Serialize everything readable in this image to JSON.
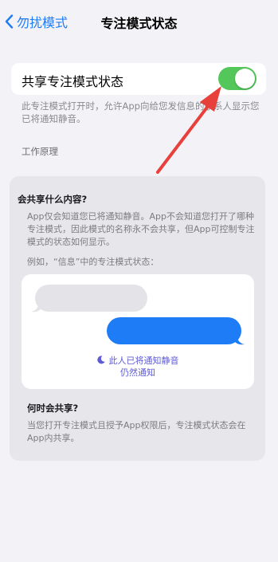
{
  "nav": {
    "back_label": "勿扰模式",
    "title": "专注模式状态"
  },
  "share_toggle": {
    "label": "共享专注模式状态",
    "on": true,
    "on_color": "#53c75a"
  },
  "footer_note": "此专注模式打开时，允许App向给您发信息的联系人显示您已将通知静音。",
  "section_header": "工作原理",
  "info_card": {
    "q1": "会共享什么内容?",
    "p1": "App仅会知道您已将通知静音。App不会知道您打开了哪种专注模式，因此模式的名称永不会共享，但App可控制专注模式的状态如何显示。",
    "example_label": "例如，“信息”中的专注模式状态：",
    "preview": {
      "notice_line1": "此人已将通知静音",
      "notice_line2": "仍然通知"
    },
    "q2": "何时会共享?",
    "p2": "当您打开专注模式且授予App权限后，专注模式状态会在App内共享。"
  },
  "colors": {
    "accent_blue": "#1e7cf6",
    "focus_purple": "#5f5bd6",
    "annotation_red": "#e8403a"
  },
  "icons": [
    "chevron-left-icon",
    "moon-icon"
  ]
}
